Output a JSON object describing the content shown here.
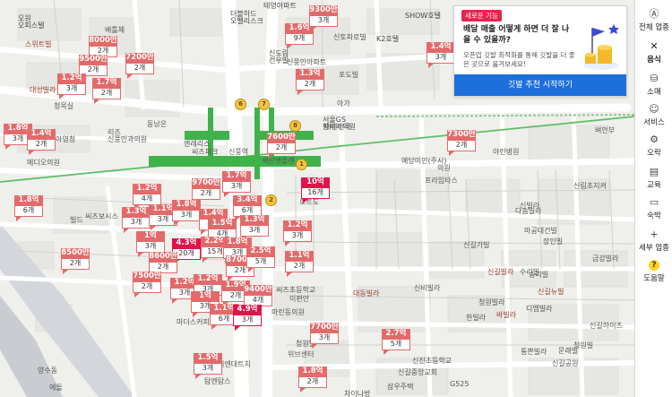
{
  "sidebar": {
    "items": [
      {
        "icon": "category-a-icon",
        "label": "전체 업종"
      },
      {
        "icon": "utensils-icon",
        "label": "음식"
      },
      {
        "icon": "shopping-bag-icon",
        "label": "소매"
      },
      {
        "icon": "smiley-icon",
        "label": "서비스"
      },
      {
        "icon": "bicycle-icon",
        "label": "오락"
      },
      {
        "icon": "book-icon",
        "label": "교육"
      },
      {
        "icon": "bed-icon",
        "label": "숙박"
      },
      {
        "icon": "plus-icon",
        "label": "세부 업종"
      },
      {
        "icon": "help-icon",
        "label": "도움말"
      }
    ]
  },
  "promo": {
    "badge": "새로운 기능",
    "title": "배달 매출 어떻게 하면 더 잘 나올 수 있을까?",
    "desc": "오픈업 깃발 최적화를 통해 깃발을 더 좋은 곳으로 옮겨보세요!",
    "cta": "깃발 추천 시작하기"
  },
  "colors": {
    "pin": "#e36a6a",
    "pin_hot": "#e0134a",
    "subway": "#3fb24a",
    "promo_cta": "#1d6fdb"
  },
  "pins": [
    {
      "price": "8000만",
      "count": "2개"
    },
    {
      "price": "9500만",
      "count": "2개"
    },
    {
      "price": "7200만",
      "count": "2개"
    },
    {
      "price": "1.2억",
      "count": "3개"
    },
    {
      "price": "1.7억",
      "count": "2개"
    },
    {
      "price": "1.6억",
      "count": "9개"
    },
    {
      "price": "9300만",
      "count": "3개"
    },
    {
      "price": "1.4억",
      "count": "3개"
    },
    {
      "price": "1.3억",
      "count": "2개"
    },
    {
      "price": "1.8억",
      "count": "3개"
    },
    {
      "price": "1.4억",
      "count": "2개"
    },
    {
      "price": "7600만",
      "count": "2개"
    },
    {
      "price": "7300만",
      "count": "2개"
    },
    {
      "price": "10억",
      "count": "16개"
    },
    {
      "price": "1.8억",
      "count": "6개"
    },
    {
      "price": "1.2억",
      "count": "4개"
    },
    {
      "price": "9700만",
      "count": "2개"
    },
    {
      "price": "1.7억",
      "count": "3개"
    },
    {
      "price": "1.3억",
      "count": "3개"
    },
    {
      "price": "1.1억",
      "count": "3개"
    },
    {
      "price": "1.8억",
      "count": "3개"
    },
    {
      "price": "3.4억",
      "count": "6개"
    },
    {
      "price": "1.4억",
      "count": "3개"
    },
    {
      "price": "1.5억",
      "count": "4개"
    },
    {
      "price": "1.3억",
      "count": "3개"
    },
    {
      "price": "1.2억",
      "count": "3개"
    },
    {
      "price": "1억",
      "count": "3개"
    },
    {
      "price": "4.3억",
      "count": "20개"
    },
    {
      "price": "2.2억",
      "count": "15개"
    },
    {
      "price": "1.8억",
      "count": "3개"
    },
    {
      "price": "8600만",
      "count": "2개"
    },
    {
      "price": "8700만",
      "count": "2개"
    },
    {
      "price": "2.5억",
      "count": "5개"
    },
    {
      "price": "1.1억",
      "count": "2개"
    },
    {
      "price": "8500만",
      "count": "2개"
    },
    {
      "price": "7500만",
      "count": "2개"
    },
    {
      "price": "1.2억",
      "count": "3개"
    },
    {
      "price": "1.2억",
      "count": "3개"
    },
    {
      "price": "1.9억",
      "count": "2개"
    },
    {
      "price": "9400만",
      "count": "4개"
    },
    {
      "price": "1억",
      "count": "3개"
    },
    {
      "price": "1.1억",
      "count": "6개"
    },
    {
      "price": "4.9억",
      "count": "3개"
    },
    {
      "price": "7700만",
      "count": "3개"
    },
    {
      "price": "2.7억",
      "count": "5개"
    },
    {
      "price": "1.5억",
      "count": "3개"
    },
    {
      "price": "1.8억",
      "count": "2개"
    }
  ],
  "labels": [
    "오원\n오피스텔",
    "배틀체",
    "스위트빌",
    "더블하드\n오벨리스크",
    "테영아파트",
    "SHOW호텔",
    "K2호텔",
    "신토파로빌",
    "신도림\n건우빌",
    "신풍인아파트",
    "포도빌",
    "아가",
    "대성빌라",
    "청목실",
    "동남은",
    "아영청",
    "엔레리스",
    "씨즈파크",
    "신풍역",
    "세븐앤플렌",
    "서울GS\n황씨과의원",
    "리즈\n신풍인과의원",
    "메디오의원",
    "대한민국",
    "예당미민(주시)",
    "의원",
    "야린병원",
    "프라임타스",
    "신림초지켜",
    "벼안부",
    "마공대건빌",
    "장인빌",
    "로트도",
    "씨즈보시스",
    "빌드",
    "신빌라",
    "다솜빌라",
    "신길가빌",
    "수리빌",
    "승리빌",
    "금강빌라",
    "신길빌라",
    "씨즈초등학교",
    "바빌라",
    "디엠빌라",
    "대동빌라",
    "신비빌라",
    "청원빌라",
    "신길뉴빌",
    "한빌라",
    "통쁜빌라",
    "신길하이츠",
    "청원빌",
    "신길공원",
    "신진초등학교",
    "문래빌",
    "마더스커피",
    "이편안",
    "마린동의원",
    "미엔대트치",
    "탐엔탐스",
    "삼우주택",
    "차이나방",
    "G525",
    "신길중앙교회",
    "위브센터",
    "청원빌",
    "양수동",
    "에돌"
  ]
}
